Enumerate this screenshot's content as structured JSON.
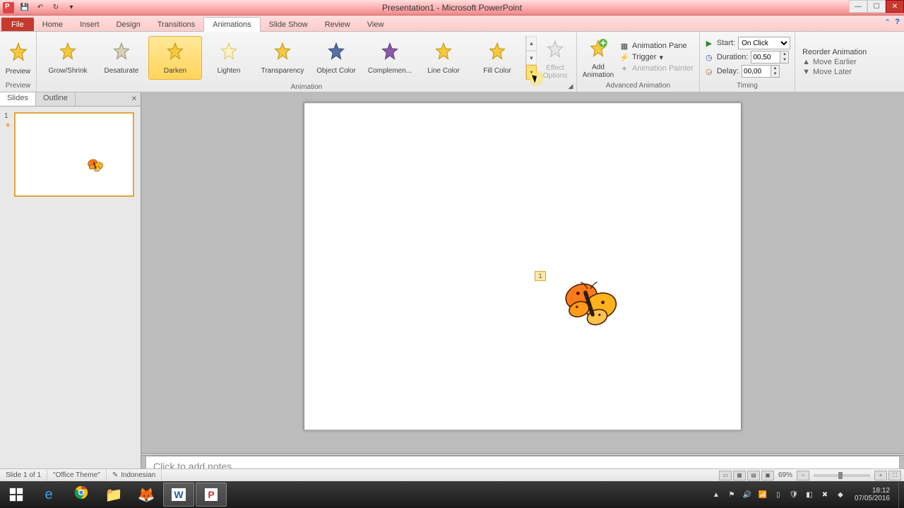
{
  "app": {
    "title": "Presentation1 - Microsoft PowerPoint"
  },
  "tabs": {
    "file": "File",
    "home": "Home",
    "insert": "Insert",
    "design": "Design",
    "transitions": "Transitions",
    "animations": "Animations",
    "slideshow": "Slide Show",
    "review": "Review",
    "view": "View"
  },
  "ribbon": {
    "preview": {
      "label": "Preview",
      "group": "Preview"
    },
    "animation_group": "Animation",
    "gallery": [
      {
        "label": "Grow/Shrink",
        "fill": "#f5c93d",
        "stroke": "#c79a1a"
      },
      {
        "label": "Desaturate",
        "fill": "#d6d0b8",
        "stroke": "#a19a7d"
      },
      {
        "label": "Darken",
        "fill": "#f5c93d",
        "stroke": "#c79a1a",
        "selected": true
      },
      {
        "label": "Lighten",
        "fill": "#fff4c2",
        "stroke": "#dcca7a"
      },
      {
        "label": "Transparency",
        "fill": "#f5c93d",
        "stroke": "#c79a1a"
      },
      {
        "label": "Object Color",
        "fill": "#5a6fa8",
        "stroke": "#39507f"
      },
      {
        "label": "Complemen...",
        "fill": "#8a5aa8",
        "stroke": "#6a3f86"
      },
      {
        "label": "Line Color",
        "fill": "#f5c93d",
        "stroke": "#c79a1a"
      },
      {
        "label": "Fill Color",
        "fill": "#f5c93d",
        "stroke": "#c79a1a"
      }
    ],
    "effect_options": "Effect\nOptions",
    "add_animation": "Add\nAnimation",
    "adv": {
      "pane": "Animation Pane",
      "trigger": "Trigger",
      "painter": "Animation Painter",
      "group": "Advanced Animation"
    },
    "timing": {
      "start_label": "Start:",
      "start_value": "On Click",
      "duration_label": "Duration:",
      "duration_value": "00,50",
      "delay_label": "Delay:",
      "delay_value": "00,00",
      "group": "Timing"
    },
    "reorder": {
      "title": "Reorder Animation",
      "earlier": "Move Earlier",
      "later": "Move Later"
    }
  },
  "panel": {
    "slides_tab": "Slides",
    "outline_tab": "Outline",
    "slide_num": "1"
  },
  "slide": {
    "anim_tag": "1"
  },
  "notes": {
    "placeholder": "Click to add notes"
  },
  "status": {
    "slide": "Slide 1 of 1",
    "theme": "\"Office Theme\"",
    "language": "Indonesian",
    "zoom": "69%"
  },
  "tray": {
    "time": "18:12",
    "date": "07/05/2016"
  }
}
